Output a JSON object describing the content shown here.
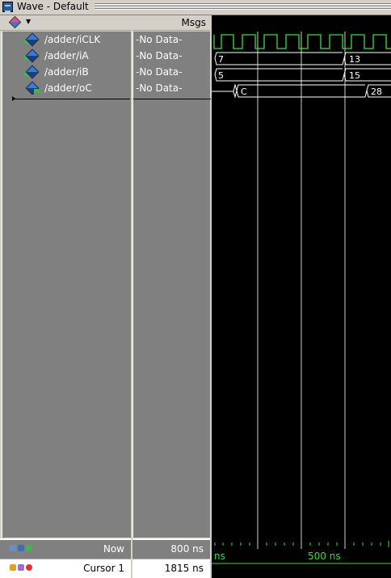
{
  "window": {
    "title": "Wave - Default"
  },
  "header": {
    "msgs_label": "Msgs"
  },
  "signals": [
    {
      "name": "/adder/iCLK",
      "value": "-No Data-"
    },
    {
      "name": "/adder/iA",
      "value": "-No Data-"
    },
    {
      "name": "/adder/iB",
      "value": "-No Data-"
    },
    {
      "name": "/adder/oC",
      "value": "-No Data-"
    }
  ],
  "footer": {
    "now_label": "Now",
    "now_value": "800 ns",
    "cursor_label": "Cursor 1",
    "cursor_value": "1815 ns"
  },
  "timeline": {
    "unit_label_left": "ns",
    "tick_label": "500 ns"
  },
  "wave_values": {
    "iA": [
      "7",
      "13"
    ],
    "iB": [
      "5",
      "15"
    ],
    "oC": [
      "C",
      "28"
    ]
  },
  "colors": {
    "wave": "#3cdc3c",
    "background": "#000000",
    "cursor_line": "#ffffff"
  },
  "icons": [
    "wave-window-icon",
    "signal-diamond-icon",
    "dropdown-arrow-icon",
    "zoom-icons"
  ]
}
